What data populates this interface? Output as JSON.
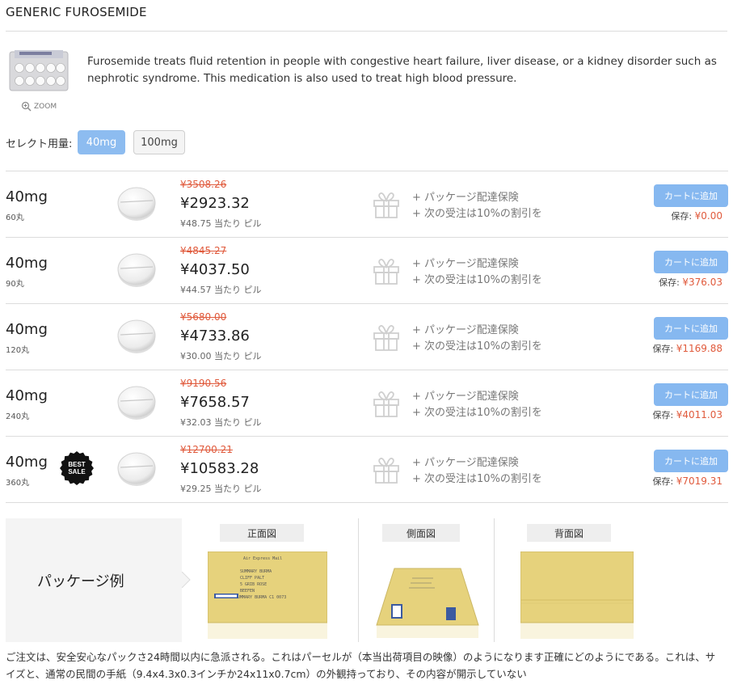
{
  "title": "GENERIC FUROSEMIDE",
  "product": {
    "zoom_label": "ZOOM",
    "description": "Furosemide treats fluid retention in people with congestive heart failure, liver disease, or a kidney disorder such as nephrotic syndrome. This medication is also used to treat high blood pressure."
  },
  "dose_select": {
    "label": "セレクト用量:",
    "options": [
      "40mg",
      "100mg"
    ],
    "selected": "40mg"
  },
  "rows": [
    {
      "dose": "40mg",
      "qty": "60丸",
      "old_price": "¥3508.26",
      "price": "¥2923.32",
      "per_pill": "¥48.75 当たり ピル",
      "perk1": "+ パッケージ配達保険",
      "perk2": "+ 次の受注は10%の割引を",
      "cart_label": "カートに追加",
      "save_label": "保存:",
      "save_amount": "¥0.00",
      "best_sale": false
    },
    {
      "dose": "40mg",
      "qty": "90丸",
      "old_price": "¥4845.27",
      "price": "¥4037.50",
      "per_pill": "¥44.57 当たり ピル",
      "perk1": "+ パッケージ配達保険",
      "perk2": "+ 次の受注は10%の割引を",
      "cart_label": "カートに追加",
      "save_label": "保存:",
      "save_amount": "¥376.03",
      "best_sale": false
    },
    {
      "dose": "40mg",
      "qty": "120丸",
      "old_price": "¥5680.00",
      "price": "¥4733.86",
      "per_pill": "¥30.00 当たり ピル",
      "perk1": "+ パッケージ配達保険",
      "perk2": "+ 次の受注は10%の割引を",
      "cart_label": "カートに追加",
      "save_label": "保存:",
      "save_amount": "¥1169.88",
      "best_sale": false
    },
    {
      "dose": "40mg",
      "qty": "240丸",
      "old_price": "¥9190.56",
      "price": "¥7658.57",
      "per_pill": "¥32.03 当たり ピル",
      "perk1": "+ パッケージ配達保険",
      "perk2": "+ 次の受注は10%の割引を",
      "cart_label": "カートに追加",
      "save_label": "保存:",
      "save_amount": "¥4011.03",
      "best_sale": false
    },
    {
      "dose": "40mg",
      "qty": "360丸",
      "old_price": "¥12700.21",
      "price": "¥10583.28",
      "per_pill": "¥29.25 当たり ピル",
      "perk1": "+ パッケージ配達保険",
      "perk2": "+ 次の受注は10%の割引を",
      "cart_label": "カートに追加",
      "save_label": "保存:",
      "save_amount": "¥7019.31",
      "best_sale": true
    }
  ],
  "best_sale_badge": {
    "line1": "BEST",
    "line2": "SALE"
  },
  "package": {
    "label": "パッケージ例",
    "views": [
      "正面図",
      "側面図",
      "背面図"
    ],
    "envelope_text": [
      "SUMMARY BURMA",
      "CLIFF PALT",
      "5 GRIB ROSE",
      "BEEFEN",
      "SUMMARY BURMA C1 0073"
    ]
  },
  "note": "ご注文は、安全安心なパックさ24時間以内に急派される。これはパーセルが（本当出荷項目の映像）のようになります正確にどのようにである。これは、サイズと、通常の民間の手紙（9.4x4.3x0.3インチか24x11x0.7cm）の外観持っており、その内容が開示していない",
  "colors": {
    "accent": "#8dbcf0",
    "sale": "#e05a3c",
    "border": "#dcdcdc"
  }
}
